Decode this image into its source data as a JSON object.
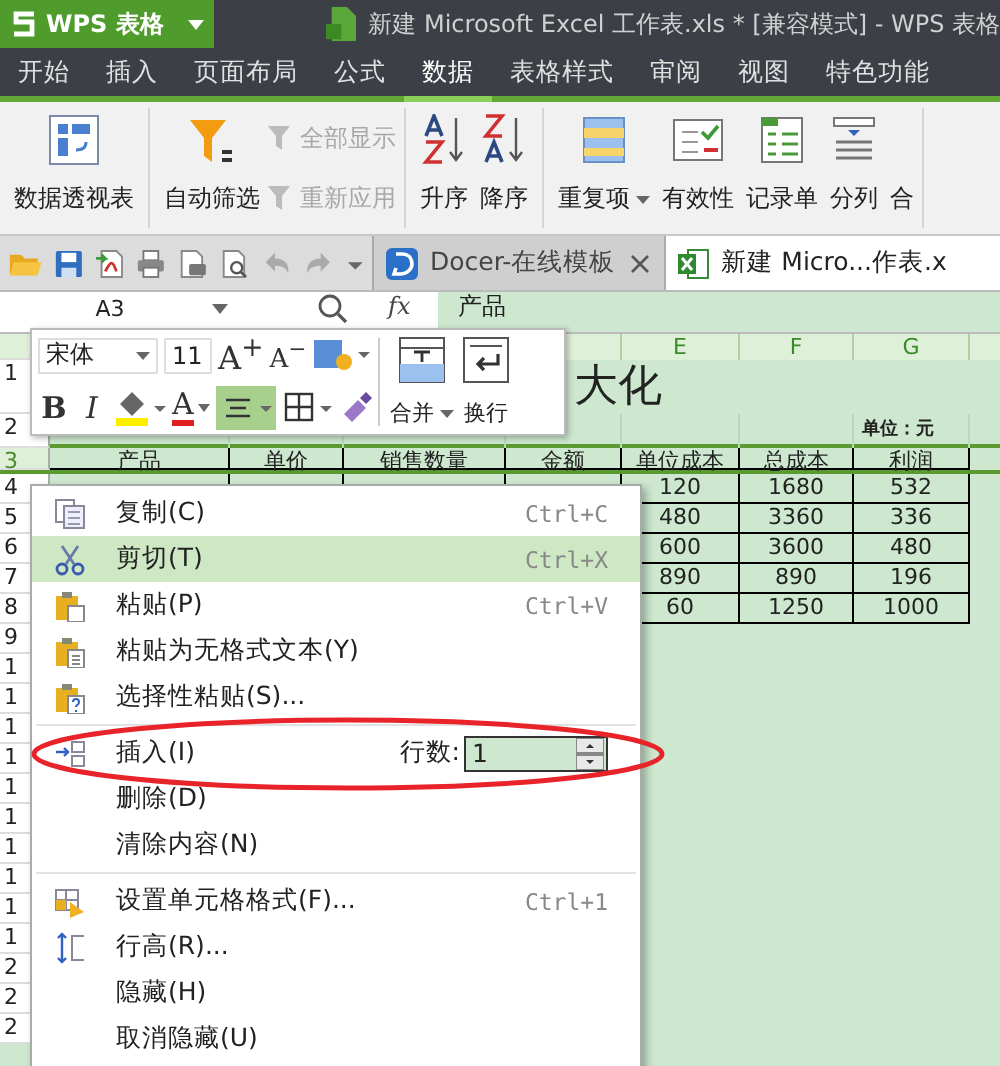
{
  "title_bar": {
    "app_button": "WPS 表格",
    "title": "新建 Microsoft Excel 工作表.xls * [兼容模式] - WPS 表格"
  },
  "menu_tabs": [
    {
      "label": "开始",
      "selected": false
    },
    {
      "label": "插入",
      "selected": false
    },
    {
      "label": "页面布局",
      "selected": false
    },
    {
      "label": "公式",
      "selected": false
    },
    {
      "label": "数据",
      "selected": true
    },
    {
      "label": "表格样式",
      "selected": false
    },
    {
      "label": "审阅",
      "selected": false
    },
    {
      "label": "视图",
      "selected": false
    },
    {
      "label": "特色功能",
      "selected": false
    }
  ],
  "ribbon": {
    "pivot_table": "数据透视表",
    "auto_filter": "自动筛选",
    "show_all": {
      "label": "全部显示",
      "disabled": true
    },
    "reapply": {
      "label": "重新应用",
      "disabled": true
    },
    "sort_ascending": "升序",
    "sort_descending": "降序",
    "duplicates": "重复项",
    "validity": "有效性",
    "record_form": "记录单",
    "split_column": "分列",
    "cut_off": "合"
  },
  "doc_tabs": [
    {
      "label": "Docer-在线模板",
      "selected": false
    },
    {
      "label": "新建 Micro...作表.x",
      "selected": true
    }
  ],
  "formula_bar": {
    "name_box": "A3",
    "fx": "fx",
    "content": "产品"
  },
  "sheet": {
    "column_headers": [
      "E",
      "F",
      "G"
    ],
    "row_numbers": [
      {
        "label": "1",
        "selected": false
      },
      {
        "label": "2",
        "selected": false
      },
      {
        "label": "3",
        "selected": true
      },
      {
        "label": "4",
        "selected": false
      },
      {
        "label": "5",
        "selected": false
      },
      {
        "label": "6",
        "selected": false
      },
      {
        "label": "7",
        "selected": false
      },
      {
        "label": "8",
        "selected": false
      },
      {
        "label": "9",
        "selected": false
      },
      {
        "label": "1",
        "selected": false
      },
      {
        "label": "1",
        "selected": false
      },
      {
        "label": "1",
        "selected": false
      },
      {
        "label": "1",
        "selected": false
      },
      {
        "label": "1",
        "selected": false
      },
      {
        "label": "1",
        "selected": false
      },
      {
        "label": "1",
        "selected": false
      },
      {
        "label": "1",
        "selected": false
      },
      {
        "label": "1",
        "selected": false
      },
      {
        "label": "1",
        "selected": false
      },
      {
        "label": "2",
        "selected": false
      },
      {
        "label": "2",
        "selected": false
      },
      {
        "label": "2",
        "selected": false
      }
    ],
    "title": "大化",
    "unit": "单位：元",
    "table_header": [
      "产品",
      "单价",
      "销售数量",
      "金额",
      "单位成本",
      "总成本",
      "利润"
    ],
    "table_rows": [
      [
        "120",
        "1680",
        "532"
      ],
      [
        "480",
        "3360",
        "336"
      ],
      [
        "600",
        "3600",
        "480"
      ],
      [
        "890",
        "890",
        "196"
      ],
      [
        "60",
        "1250",
        "1000"
      ]
    ]
  },
  "mini_toolbar": {
    "font": "宋体",
    "font_size": "11",
    "increase_font": "A$^{+}$",
    "decrease_font": "A$^{−}$",
    "bold": "B",
    "italic": "I",
    "font_color": "A",
    "align": {
      "selected": true
    },
    "merge": "合并",
    "wrap": "换行"
  },
  "context_menu": {
    "sections": [
      [
        {
          "kind": "command",
          "label": "复制(C)",
          "shortcut": "Ctrl+C",
          "highlighted": false
        },
        {
          "kind": "command",
          "label": "剪切(T)",
          "shortcut": "Ctrl+X",
          "highlighted": true
        },
        {
          "kind": "command",
          "label": "粘贴(P)",
          "shortcut": "Ctrl+V",
          "highlighted": false
        },
        {
          "kind": "command",
          "label": "粘贴为无格式文本(Y)",
          "highlighted": false
        },
        {
          "kind": "command",
          "label": "选择性粘贴(S)...",
          "highlighted": false
        }
      ],
      [
        {
          "kind": "insert",
          "label": "插入(I)",
          "count_label": "行数:",
          "count": "1",
          "highlighted": false
        },
        {
          "kind": "command",
          "label": "删除(D)",
          "highlighted": false
        },
        {
          "kind": "command",
          "label": "清除内容(N)",
          "highlighted": false
        }
      ],
      [
        {
          "kind": "command",
          "label": "设置单元格格式(F)...",
          "shortcut": "Ctrl+1",
          "highlighted": false
        },
        {
          "kind": "command",
          "label": "行高(R)...",
          "highlighted": false
        },
        {
          "kind": "command",
          "label": "隐藏(H)",
          "highlighted": false
        },
        {
          "kind": "command",
          "label": "取消隐藏(U)",
          "highlighted": false
        }
      ]
    ]
  }
}
